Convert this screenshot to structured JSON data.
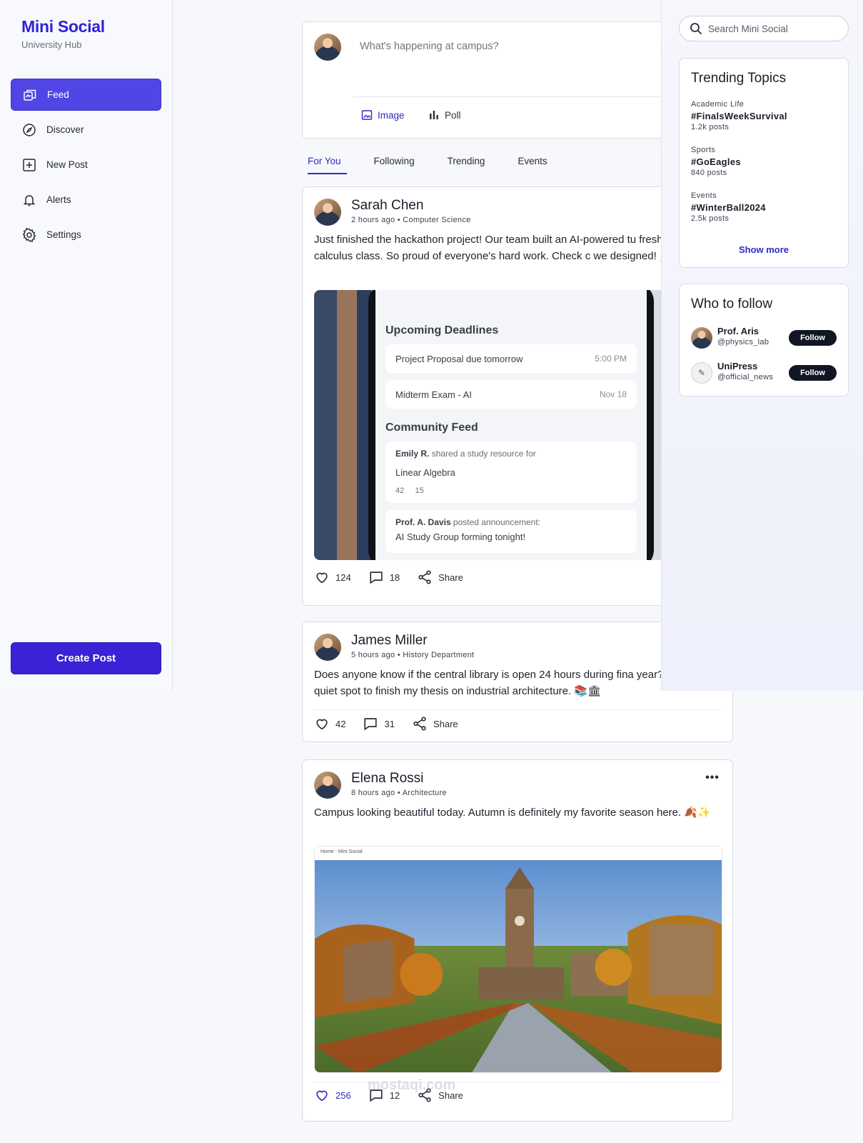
{
  "brand": {
    "title": "Mini Social",
    "subtitle": "University Hub"
  },
  "nav": {
    "items": [
      {
        "label": "Feed",
        "icon": "feed-icon",
        "active": true
      },
      {
        "label": "Discover",
        "icon": "compass-icon"
      },
      {
        "label": "New Post",
        "icon": "plus-square-icon"
      },
      {
        "label": "Alerts",
        "icon": "bell-icon"
      },
      {
        "label": "Settings",
        "icon": "gear-icon"
      }
    ],
    "create_label": "Create Post"
  },
  "composer": {
    "placeholder": "What's happening at campus?",
    "image_label": "Image",
    "poll_label": "Poll"
  },
  "tabs": [
    "For You",
    "Following",
    "Trending",
    "Events"
  ],
  "posts": [
    {
      "name": "Sarah Chen",
      "meta": "2 hours ago • Computer Science",
      "text": "Just finished the hackathon project! Our team built an AI-powered tu freshman calculus class. So proud of everyone's hard work. Check c we designed! 💻✨",
      "likes": "124",
      "comments": "18",
      "share": "Share",
      "image": {
        "upcoming": "Upcoming Deadlines",
        "deadline1": "Project Proposal due tomorrow",
        "deadline1_time": "5:00 PM",
        "deadline2": "Midterm Exam - AI",
        "deadline2_time": "Nov 18",
        "community": "Community Feed",
        "feed1_author": "Emily R.",
        "feed1_action": "shared a study resource for",
        "feed1_title": "Linear Algebra",
        "feed1_likes": "42",
        "feed1_comments": "15",
        "feed2_author": "Prof. A. Davis",
        "feed2_action": "posted announcement:",
        "feed2_title": "AI Study Group forming tonight!"
      }
    },
    {
      "name": "James Miller",
      "meta": "5 hours ago • History Department",
      "text": "Does anyone know if the central library is open 24 hours during fina year? Need a quiet spot to finish my thesis on industrial architecture. 📚🏛",
      "likes": "42",
      "comments": "31",
      "share": "Share"
    },
    {
      "name": "Elena Rossi",
      "meta": "8 hours ago • Architecture",
      "text": "Campus looking beautiful today. Autumn is definitely my favorite season here. 🍂✨",
      "likes": "256",
      "comments": "12",
      "share": "Share",
      "image_caption": "Home - Mini Social"
    }
  ],
  "search": {
    "placeholder": "Search Mini Social"
  },
  "trending": {
    "title": "Trending Topics",
    "items": [
      {
        "category": "Academic Life",
        "tag": "#FinalsWeekSurvival",
        "count": "1.2k posts"
      },
      {
        "category": "Sports",
        "tag": "#GoEagles",
        "count": "840 posts"
      },
      {
        "category": "Events",
        "tag": "#WinterBall2024",
        "count": "2.5k posts"
      }
    ],
    "show_more": "Show more"
  },
  "who_to_follow": {
    "title": "Who to follow",
    "items": [
      {
        "name": "Prof. Aris",
        "handle": "@physics_lab",
        "button": "Follow"
      },
      {
        "name": "UniPress",
        "handle": "@official_news",
        "button": "Follow"
      }
    ]
  },
  "watermark": "mostaqi.com",
  "colors": {
    "accent": "#4f46e5",
    "brand": "#2f22d6",
    "link": "#2f2cbf",
    "dark_button": "#111624"
  }
}
